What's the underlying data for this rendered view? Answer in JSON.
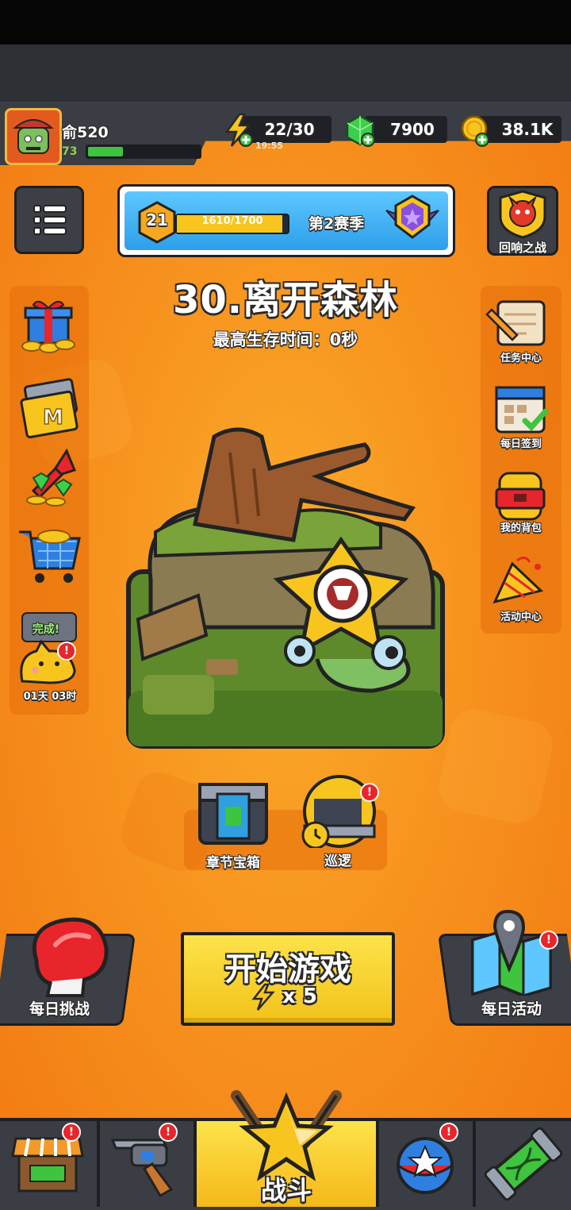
{
  "player": {
    "name": "俞520",
    "level": "73",
    "xp_fraction": 0.3
  },
  "resources": {
    "energy": {
      "value": "22/30",
      "timer": "19:55"
    },
    "gems": {
      "value": "7900"
    },
    "coins": {
      "value": "38.1K"
    }
  },
  "season": {
    "level": "21",
    "progress": "1610/1700",
    "progress_fraction": 0.947,
    "label": "第2赛季"
  },
  "echo_battle": {
    "label": "回响之战"
  },
  "chapter": {
    "title": "30.离开森林",
    "best_time": "最高生存时间：0秒"
  },
  "left_panel": {
    "timer_badge": "完成!",
    "timer": "01天 03时"
  },
  "right_panel": {
    "items": [
      {
        "label": "任务中心"
      },
      {
        "label": "每日签到"
      },
      {
        "label": "我的背包"
      },
      {
        "label": "活动中心"
      }
    ]
  },
  "chapter_chest": {
    "label": "章节宝箱"
  },
  "patrol": {
    "label": "巡逻"
  },
  "daily_challenge": {
    "label": "每日挑战"
  },
  "daily_event": {
    "label": "每日活动"
  },
  "start_game": {
    "label": "开始游戏",
    "cost": "x 5"
  },
  "nav": {
    "battle_label": "战斗"
  },
  "colors": {
    "accent": "#f7931f",
    "button_yellow": "#f7d52a",
    "badge_red": "#e8252b",
    "panel_dark": "#3a3d43"
  }
}
